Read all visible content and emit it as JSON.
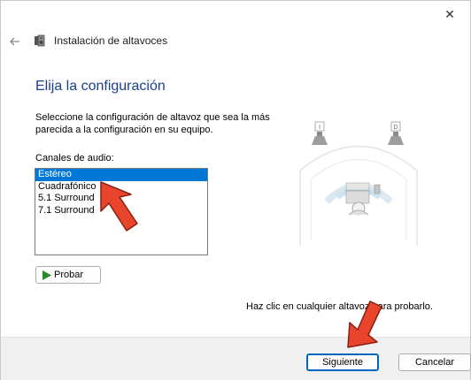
{
  "window": {
    "title": "Instalación de altavoces",
    "close_glyph": "✕"
  },
  "page": {
    "heading": "Elija la configuración",
    "description": "Seleccione la configuración de altavoz que sea la más parecida a la configuración en su equipo.",
    "channels_label": "Canales de audio:",
    "channels": [
      {
        "label": "Estéreo",
        "selected": true
      },
      {
        "label": "Cuadrafónico",
        "selected": false
      },
      {
        "label": "5.1 Surround",
        "selected": false
      },
      {
        "label": "7.1 Surround",
        "selected": false
      }
    ],
    "test_button": "Probar",
    "hint": "Haz clic en cualquier altavoz para probarlo.",
    "speaker_left_label": "I",
    "speaker_right_label": "D"
  },
  "footer": {
    "next_button": "Siguiente",
    "cancel_button": "Cancelar"
  },
  "colors": {
    "accent": "#0078d7",
    "heading": "#1b3f8b",
    "annotation_arrow": "#e8452c"
  },
  "icons": [
    "close-icon",
    "back-arrow-icon",
    "speaker-icon",
    "play-icon",
    "speaker-left-icon",
    "speaker-right-icon",
    "listener-icon"
  ]
}
